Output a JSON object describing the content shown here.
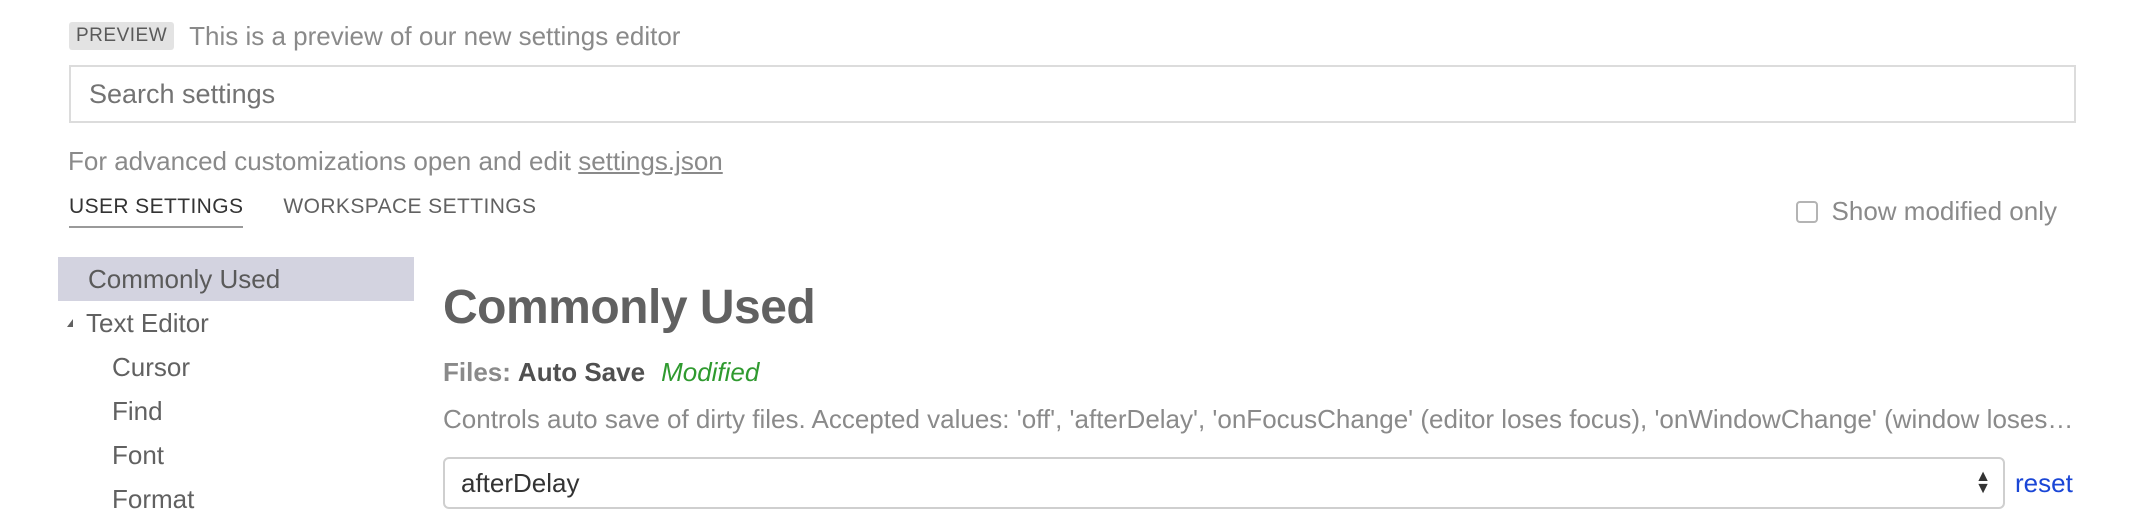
{
  "preview": {
    "badge": "PREVIEW",
    "text": "This is a preview of our new settings editor"
  },
  "search": {
    "placeholder": "Search settings",
    "value": ""
  },
  "advanced": {
    "prefix": "For advanced customizations open and edit",
    "link": "settings.json"
  },
  "tabs": [
    {
      "label": "USER SETTINGS",
      "active": true
    },
    {
      "label": "WORKSPACE SETTINGS",
      "active": false
    }
  ],
  "filter": {
    "label": "Show modified only",
    "checked": false
  },
  "sidebar": {
    "items": [
      {
        "label": "Commonly Used",
        "selected": true
      },
      {
        "label": "Text Editor",
        "expanded": true
      },
      {
        "label": "Cursor"
      },
      {
        "label": "Find"
      },
      {
        "label": "Font"
      },
      {
        "label": "Format"
      }
    ]
  },
  "main": {
    "section_title": "Commonly Used",
    "setting": {
      "category": "Files:",
      "name": "Auto Save",
      "modified_label": "Modified",
      "description": "Controls auto save of dirty files. Accepted values:  'off', 'afterDelay', 'onFocusChange' (editor loses focus), 'onWindowChange' (window loses focus). If set to 'afterDelay', you can configure the delay in 'files.autoSaveDelay'.",
      "value": "afterDelay",
      "reset_label": "reset"
    }
  },
  "colors": {
    "selected_bg": "#d3d3e0",
    "modified": "#2f9a2f",
    "link": "#1a46d6"
  },
  "icons": {
    "twisty": "triangle-expanded-icon",
    "select_arrows": "up-down-arrows-icon"
  }
}
